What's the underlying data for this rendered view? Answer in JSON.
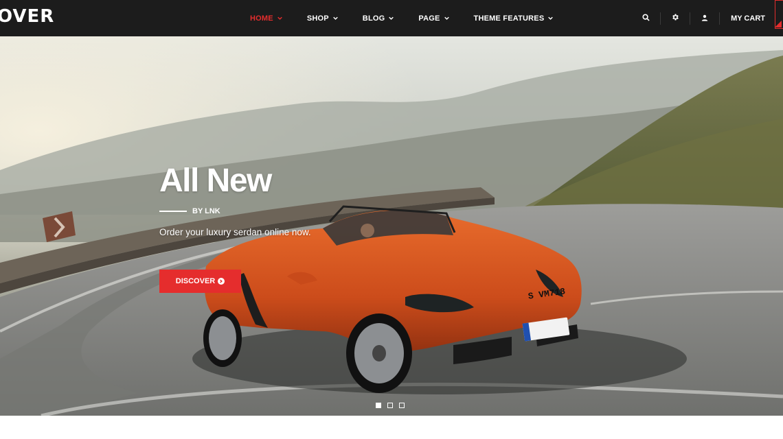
{
  "brand": {
    "logo_text": "OVER",
    "accent_color": "#e52d2d"
  },
  "nav": {
    "items": [
      {
        "label": "HOME",
        "active": true
      },
      {
        "label": "SHOP",
        "active": false
      },
      {
        "label": "BLOG",
        "active": false
      },
      {
        "label": "PAGE",
        "active": false
      },
      {
        "label": "THEME FEATURES",
        "active": false
      }
    ]
  },
  "header_tools": {
    "icons": [
      "search-icon",
      "gear-icon",
      "user-icon"
    ],
    "cart_label": "MY CART"
  },
  "hero": {
    "headline": "All New",
    "byline": "BY LNK",
    "tagline": "Order your luxury serdan online now.",
    "cta_label": "DISCOVER",
    "cta_icon": "arrow-circle-right-icon",
    "license_plate": "S VM718",
    "slides": 3,
    "active_slide": 1
  },
  "colors": {
    "header_bg": "#1c1c1c",
    "accent": "#e52d2d",
    "car": "#d4511f"
  }
}
